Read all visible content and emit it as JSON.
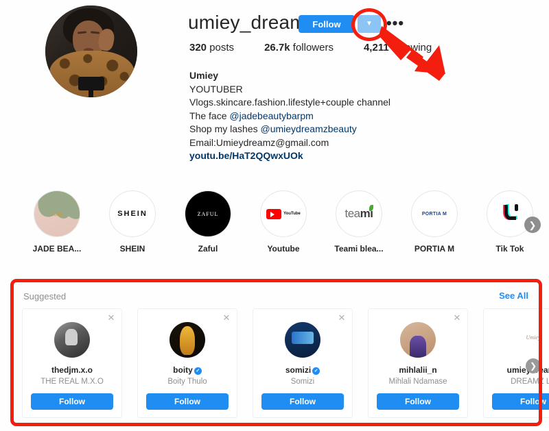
{
  "profile": {
    "username": "umiey_dreamz",
    "avatar_alt": "profile-photo",
    "follow_label": "Follow",
    "dropdown_icon": "chevron-down-icon",
    "more_icon": "ellipsis-icon",
    "more_glyph": "•••",
    "stats": [
      {
        "value": "320",
        "label": "posts"
      },
      {
        "value": "26.7k",
        "label": "followers"
      },
      {
        "value": "4,211",
        "label": "following"
      }
    ],
    "bio": {
      "name": "Umiey",
      "lines": [
        {
          "text": "YOUTUBER",
          "type": "plain"
        },
        {
          "text": "Vlogs.skincare.fashion.lifestyle+couple channel",
          "type": "plain"
        },
        {
          "text": "The face ",
          "mention": "@jadebeautybarpm",
          "type": "mention"
        },
        {
          "text": "Shop my lashes ",
          "mention": "@umieydreamzbeauty",
          "type": "mention"
        },
        {
          "text": "Email:Umieydreamz@gmail.com",
          "type": "plain"
        }
      ],
      "link": "youtu.be/HaT2QQwxUOk"
    }
  },
  "highlights": {
    "next_icon": "chevron-right-icon",
    "items": [
      {
        "label": "JADE BEA...",
        "art": "jade"
      },
      {
        "label": "SHEIN",
        "art": "shein",
        "logo_text": "SHEIN"
      },
      {
        "label": "Zaful",
        "art": "zaful",
        "logo_text": "ZAFUL"
      },
      {
        "label": "Youtube",
        "art": "youtube",
        "logo_text": "YouTube"
      },
      {
        "label": "Teami blea...",
        "art": "teami",
        "logo_text": "teami"
      },
      {
        "label": "PORTIA M",
        "art": "portia",
        "logo_text": "PORTIA M"
      },
      {
        "label": "Tik Tok",
        "art": "tiktok"
      }
    ]
  },
  "suggested": {
    "title": "Suggested",
    "see_all_label": "See All",
    "close_icon": "close-icon",
    "next_icon": "chevron-right-icon",
    "follow_label": "Follow",
    "verified_glyph": "✓",
    "cards": [
      {
        "username": "thedjm.x.o",
        "fullname": "THE REAL M.X.O",
        "verified": false,
        "art": "a-dj"
      },
      {
        "username": "boity",
        "fullname": "Boity Thulo",
        "verified": true,
        "art": "a-boity"
      },
      {
        "username": "somizi",
        "fullname": "Somizi",
        "verified": true,
        "art": "a-somizi"
      },
      {
        "username": "mihlalii_n",
        "fullname": "Mihlali Ndamase",
        "verified": false,
        "art": "a-mihlali"
      },
      {
        "username": "umieydreamz",
        "fullname": "DREAMZ LA",
        "verified": false,
        "art": "a-umiey"
      }
    ]
  },
  "annotations": {
    "highlight_color": "#f41e0f",
    "circle_target": "chevron-down-button",
    "arrow_target": "chevron-down-button",
    "rect_target": "suggested-section"
  }
}
